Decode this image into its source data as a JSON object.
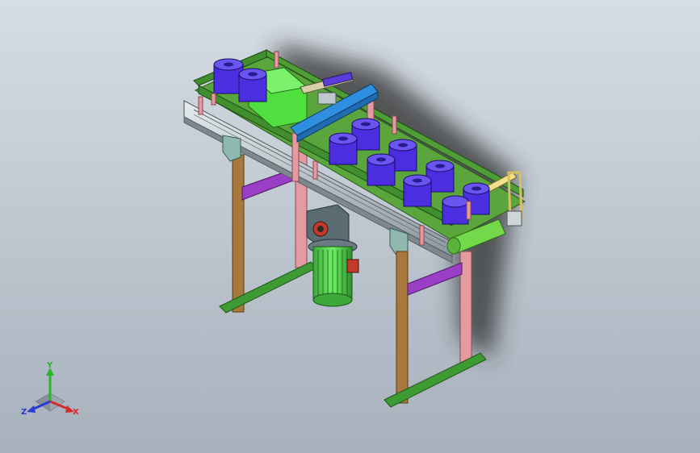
{
  "viewport": {
    "background_top": "#d6dde4",
    "background_bottom": "#a7b1bc"
  },
  "model": {
    "colors": {
      "frame_rail": "#9ea8ae",
      "conveyor_belt": "#5aa63d",
      "belt_guide": "#3f8f2e",
      "leg_brown": "#a8783c",
      "leg_pink": "#e39aa0",
      "cross_brace": "#9b3ec6",
      "foot_plate": "#3e9a32",
      "product": "#4a2ee0",
      "pusher_block": "#4fe040",
      "blue_bridge": "#2e8fe0",
      "gear_motor": "#5a6b72",
      "motor_body": "#4fd34a",
      "roller": "#74d94a",
      "end_frame": "#f0e08a",
      "shadow": "#2a2a2a"
    },
    "product_count": 10
  },
  "triad": {
    "x_label": "X",
    "y_label": "Y",
    "z_label": "Z",
    "x_color": "#d42a2a",
    "y_color": "#2ab52a",
    "z_color": "#2a3ad4"
  }
}
